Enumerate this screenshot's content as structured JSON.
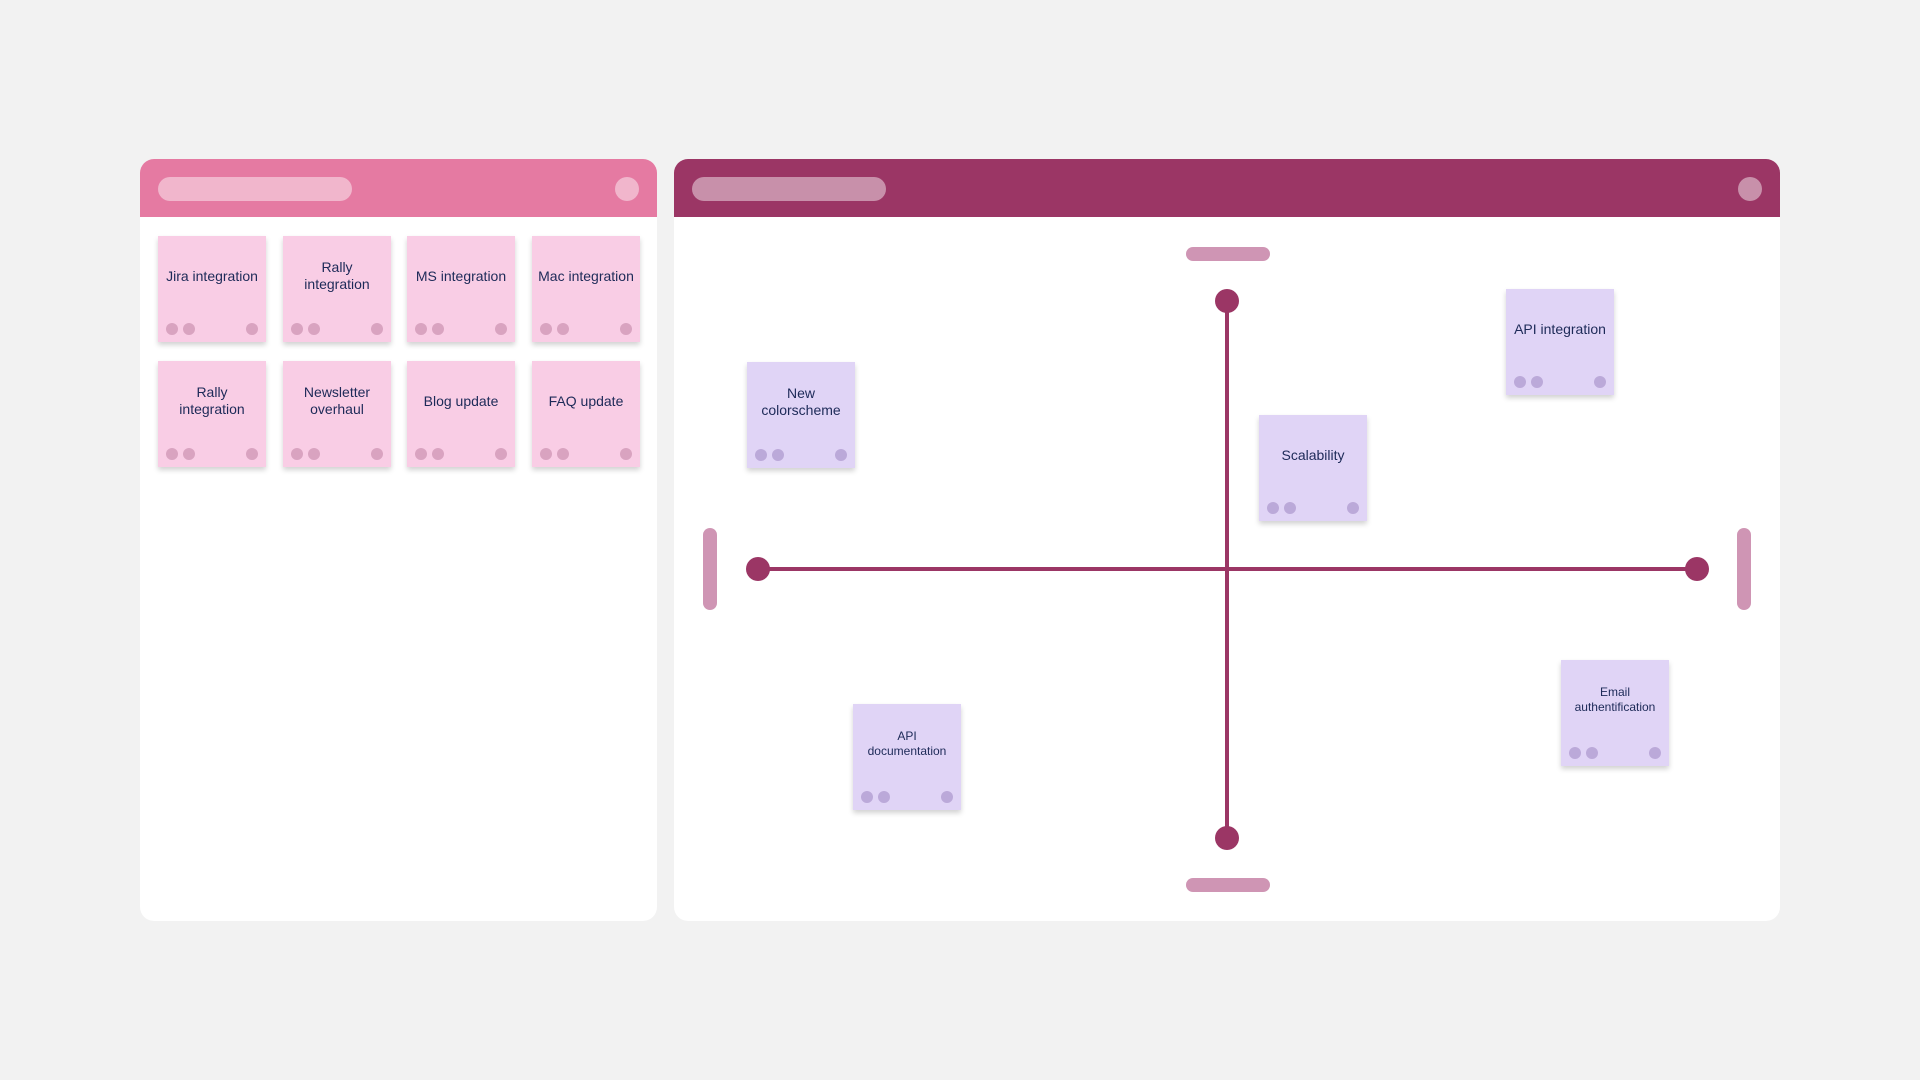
{
  "colors": {
    "background": "#f2f2f2",
    "backlog_header": "#e57aa2",
    "matrix_header": "#9b3665",
    "backlog_note": "#f9cde5",
    "backlog_note_dot": "#d9a3c0",
    "matrix_note": "#e0d4f6",
    "matrix_note_dot": "#bba9d9",
    "axis_line": "#9b3665",
    "axis_handle": "#cf95b4"
  },
  "backlog_panel": {
    "notes": [
      {
        "label": "Jira integration"
      },
      {
        "label": "Rally integration"
      },
      {
        "label": "MS integration"
      },
      {
        "label": "Mac integration"
      },
      {
        "label": "Rally integration"
      },
      {
        "label": "Newsletter overhaul"
      },
      {
        "label": "Blog update"
      },
      {
        "label": "FAQ update"
      }
    ]
  },
  "matrix_panel": {
    "notes": [
      {
        "label": "New colorscheme"
      },
      {
        "label": "Scalability"
      },
      {
        "label": "API integration"
      },
      {
        "label": "API documentation"
      },
      {
        "label": "Email authentification"
      }
    ]
  }
}
